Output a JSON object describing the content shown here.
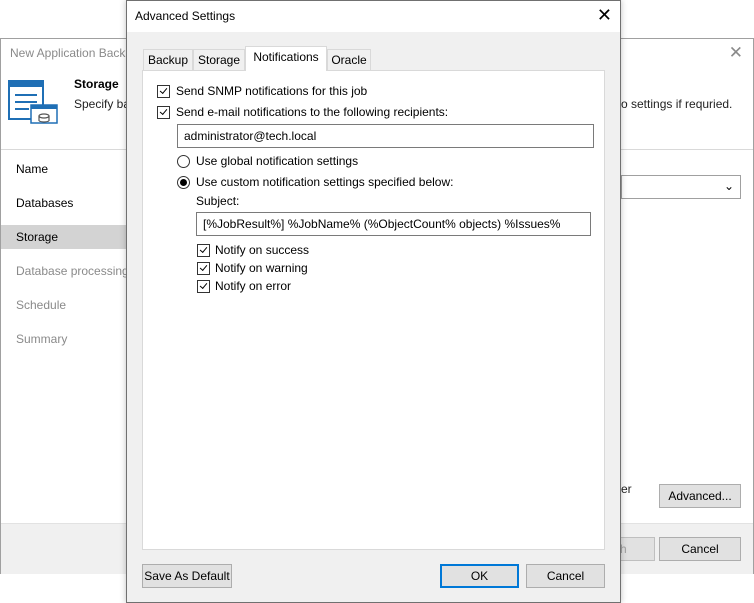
{
  "background_window": {
    "title": "New Application Back",
    "header_title": "Storage",
    "header_desc": "Specify ba",
    "header_desc_right": "o settings if requried.",
    "nav": [
      {
        "label": "Name",
        "state": "normal"
      },
      {
        "label": "Databases",
        "state": "normal"
      },
      {
        "label": "Storage",
        "state": "active"
      },
      {
        "label": "Database processing",
        "state": "disabled"
      },
      {
        "label": "Schedule",
        "state": "disabled"
      },
      {
        "label": "Summary",
        "state": "disabled"
      }
    ],
    "partial_text": "er",
    "advanced_button": "Advanced...",
    "finish_button_partial": "h",
    "cancel_button": "Cancel"
  },
  "dialog": {
    "title": "Advanced Settings",
    "tabs": [
      "Backup",
      "Storage",
      "Notifications",
      "Oracle"
    ],
    "active_tab": "Notifications",
    "snmp_checkbox": {
      "label": "Send SNMP notifications for this job",
      "checked": true
    },
    "email_checkbox": {
      "label": "Send e-mail notifications to the following recipients:",
      "checked": true
    },
    "recipients_value": "administrator@tech.local",
    "radio_global": {
      "label": "Use global notification settings",
      "selected": false
    },
    "radio_custom": {
      "label": "Use custom notification settings specified below:",
      "selected": true
    },
    "subject_label": "Subject:",
    "subject_value": "[%JobResult%] %JobName% (%ObjectCount% objects) %Issues%",
    "notify_success": {
      "label": "Notify on success",
      "checked": true
    },
    "notify_warning": {
      "label": "Notify on warning",
      "checked": true
    },
    "notify_error": {
      "label": "Notify on error",
      "checked": true
    },
    "save_default_button": "Save As Default",
    "ok_button": "OK",
    "cancel_button": "Cancel"
  },
  "colors": {
    "active_nav_bg": "#d3d3d3",
    "default_button_border": "#0078d7",
    "dialog_bg": "#f0f0f0"
  }
}
